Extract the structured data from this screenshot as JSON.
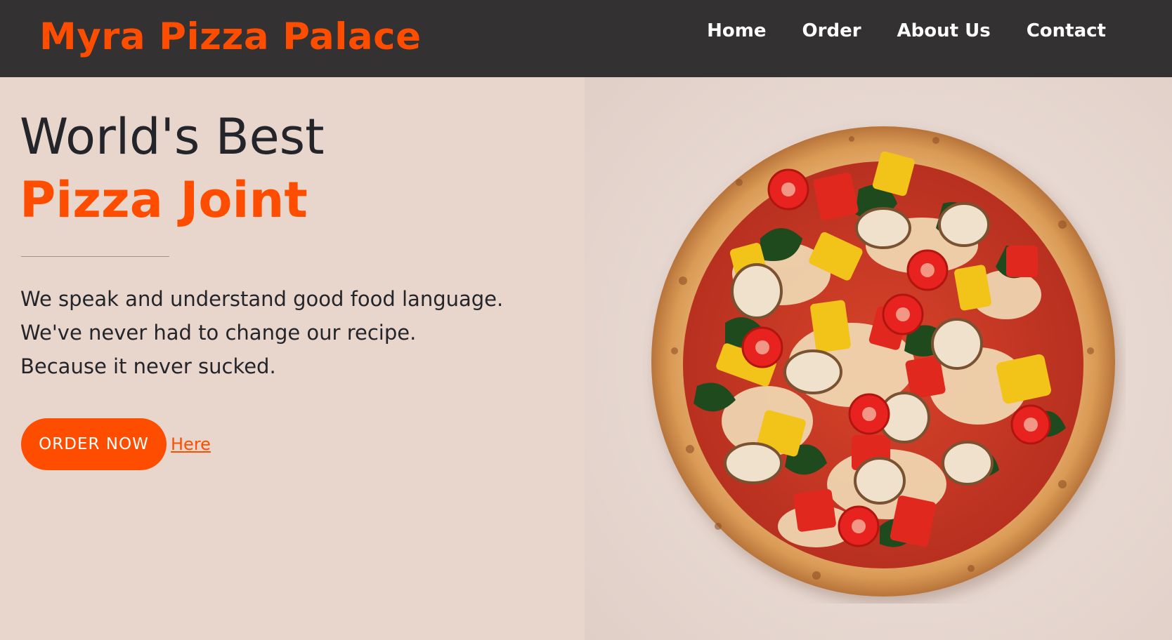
{
  "header": {
    "brand": "Myra Pizza Palace",
    "nav": [
      {
        "label": "Home"
      },
      {
        "label": "Order"
      },
      {
        "label": "About Us"
      },
      {
        "label": "Contact"
      }
    ]
  },
  "hero": {
    "headline_line1": "World's Best",
    "headline_line2": "Pizza Joint",
    "tagline": [
      "We speak and understand good food language.",
      "We've never had to change our recipe.",
      "Because it never sucked."
    ],
    "order_button_label": "ORDER NOW",
    "here_link_label": "Here",
    "image_icon": "pizza-image"
  },
  "colors": {
    "accent": "#ff4d00",
    "navbar_bg": "#333132",
    "page_bg": "#e8d6cd",
    "heading_text": "#23252a"
  }
}
